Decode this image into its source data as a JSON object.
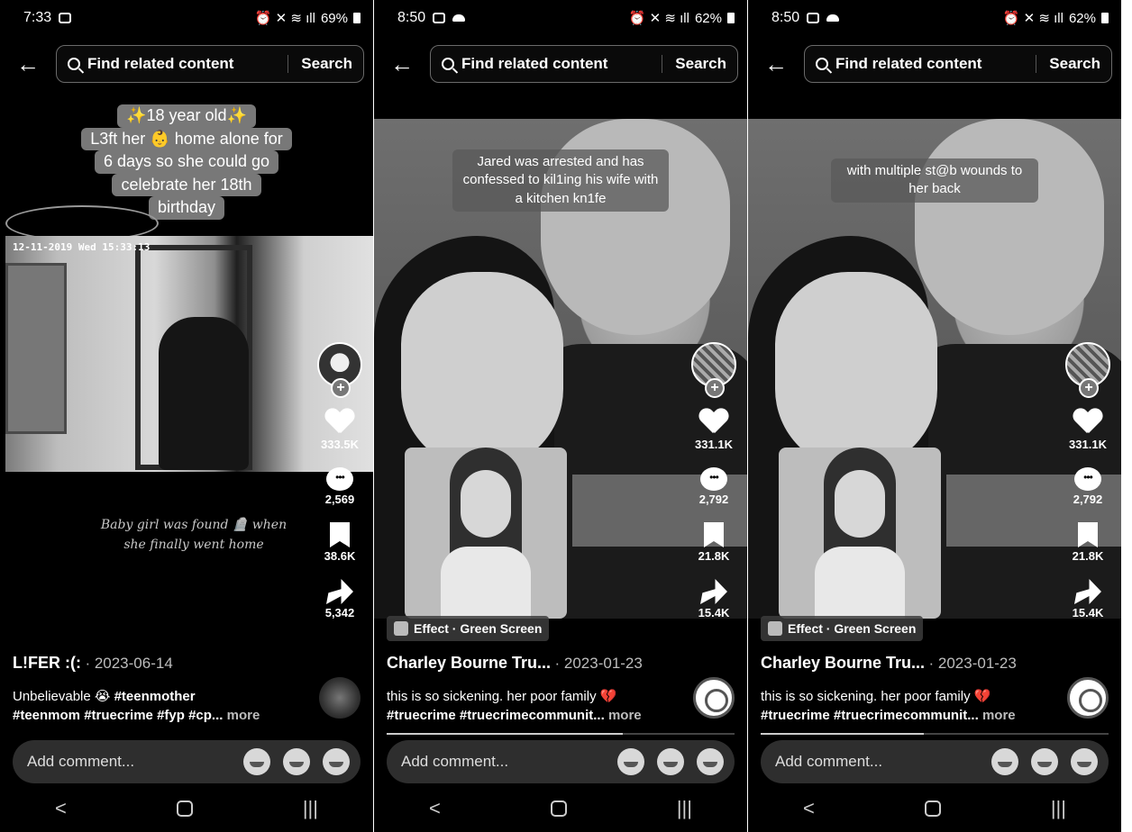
{
  "panels": [
    {
      "status": {
        "time": "7:33",
        "battery": "69%"
      },
      "search": {
        "query": "Find related content",
        "button": "Search"
      },
      "caption_lines": [
        "✨18 year old✨",
        "L3ft her 👶 home alone for",
        "6 days so she could go",
        "celebrate her 18th",
        "birthday"
      ],
      "cctv_timestamp": "12-11-2019 Wed 15:33:13",
      "overlay_text": [
        "Baby girl was found 🪦 when",
        "she finally went home"
      ],
      "actions": {
        "likes": "333.5K",
        "comments": "2,569",
        "saves": "38.6K",
        "shares": "5,342"
      },
      "author": "L!FER :(:",
      "date": "· 2023-06-14",
      "desc_text": "Unbelievable 😭",
      "hashtags_line1": "#teenmother",
      "hashtags_line2": "#teenmom #truecrime #fyp #cp...",
      "more": "more",
      "comment_placeholder": "Add comment...",
      "progress": 0
    },
    {
      "status": {
        "time": "8:50",
        "battery": "62%"
      },
      "search": {
        "query": "Find related content",
        "button": "Search"
      },
      "caption": "Jared was arrested and has confessed to kil1ing his wife with a kitchen kn1fe",
      "effect": "Effect · Green Screen",
      "actions": {
        "likes": "331.1K",
        "comments": "2,792",
        "saves": "21.8K",
        "shares": "15.4K"
      },
      "author": "Charley Bourne Tru...",
      "date": "· 2023-01-23",
      "desc_text": "this is so sickening. her poor family 💔",
      "hashtags_line2": "#truecrime #truecrimecommunit...",
      "more": "more",
      "comment_placeholder": "Add comment...",
      "progress": 0.68
    },
    {
      "status": {
        "time": "8:50",
        "battery": "62%"
      },
      "search": {
        "query": "Find related content",
        "button": "Search"
      },
      "caption": "with multiple st@b wounds to her back",
      "effect": "Effect · Green Screen",
      "actions": {
        "likes": "331.1K",
        "comments": "2,792",
        "saves": "21.8K",
        "shares": "15.4K"
      },
      "author": "Charley Bourne Tru...",
      "date": "· 2023-01-23",
      "desc_text": "this is so sickening. her poor family 💔",
      "hashtags_line2": "#truecrime #truecrimecommunit...",
      "more": "more",
      "comment_placeholder": "Add comment...",
      "progress": 0.47
    }
  ],
  "nav": {
    "back": "<",
    "recents": "|||"
  }
}
